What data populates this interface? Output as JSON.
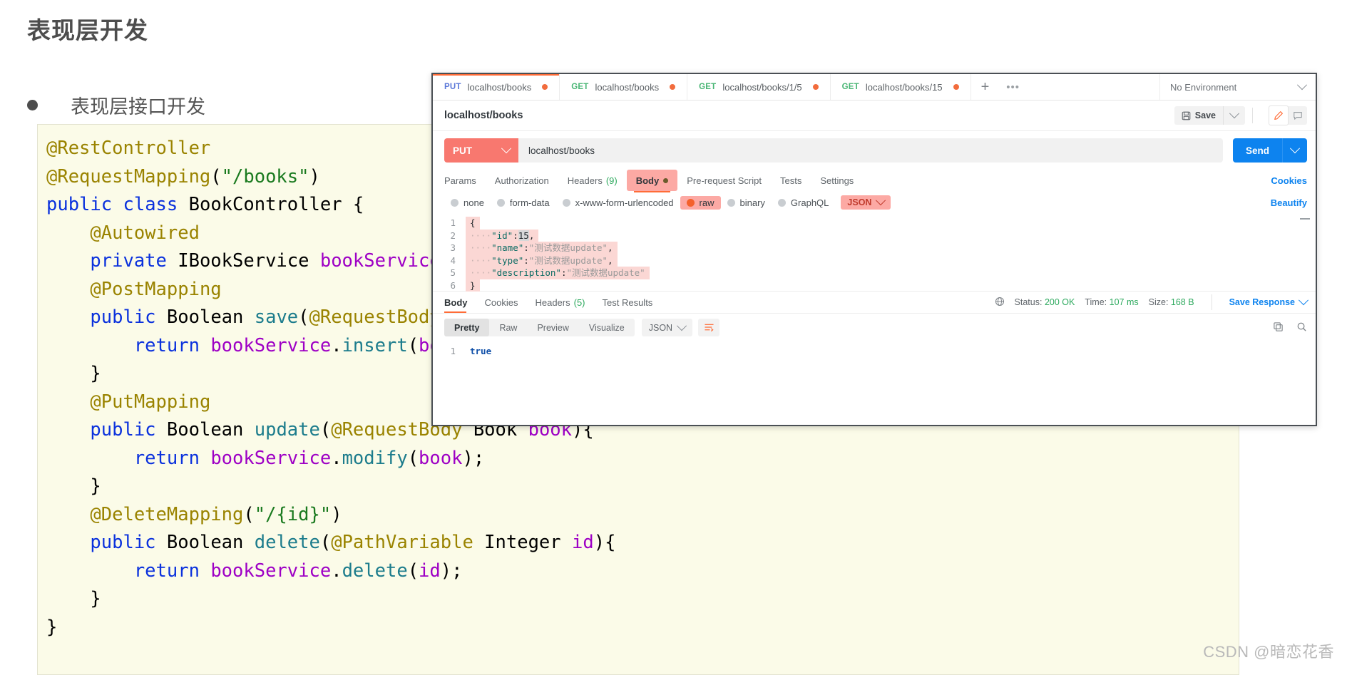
{
  "slide": {
    "title": "表现层开发",
    "bullet": "表现层接口开发",
    "watermark": "CSDN @暗恋花香"
  },
  "code": {
    "lines": [
      "@RestController",
      "@RequestMapping(\"/books\")",
      "public class BookController {",
      "    @Autowired",
      "    private IBookService bookService;",
      "    @PostMapping",
      "    public Boolean save(@RequestBody Book book){",
      "        return bookService.insert(book);",
      "    }",
      "    @PutMapping",
      "    public Boolean update(@RequestBody Book book){",
      "        return bookService.modify(book);",
      "    }",
      "    @DeleteMapping(\"/{id}\")",
      "    public Boolean delete(@PathVariable Integer id){",
      "        return bookService.delete(id);",
      "    }",
      "}"
    ]
  },
  "postman": {
    "tabs": [
      {
        "method": "PUT",
        "label": "localhost/books",
        "unsaved": true,
        "active": true
      },
      {
        "method": "GET",
        "label": "localhost/books",
        "unsaved": true,
        "active": false
      },
      {
        "method": "GET",
        "label": "localhost/books/1/5",
        "unsaved": true,
        "active": false
      },
      {
        "method": "GET",
        "label": "localhost/books/15",
        "unsaved": true,
        "active": false
      }
    ],
    "tab_add_label": "+",
    "tab_more_label": "•••",
    "environment": "No Environment",
    "request": {
      "name": "localhost/books",
      "save_label": "Save",
      "method": "PUT",
      "url": "localhost/books",
      "send_label": "Send",
      "tabs": [
        {
          "label": "Params",
          "selected": false
        },
        {
          "label": "Authorization",
          "selected": false
        },
        {
          "label": "Headers",
          "count": "(9)",
          "selected": false
        },
        {
          "label": "Body",
          "selected": true
        },
        {
          "label": "Pre-request Script",
          "selected": false
        },
        {
          "label": "Tests",
          "selected": false
        },
        {
          "label": "Settings",
          "selected": false
        }
      ],
      "cookies_link": "Cookies",
      "body_types": [
        {
          "label": "none",
          "selected": false
        },
        {
          "label": "form-data",
          "selected": false
        },
        {
          "label": "x-www-form-urlencoded",
          "selected": false
        },
        {
          "label": "raw",
          "selected": true
        },
        {
          "label": "binary",
          "selected": false
        },
        {
          "label": "GraphQL",
          "selected": false
        }
      ],
      "raw_format": "JSON",
      "beautify_link": "Beautify",
      "body_lines": [
        {
          "no": "1",
          "text": "{"
        },
        {
          "no": "2",
          "text": "····\"id\":15,"
        },
        {
          "no": "3",
          "text": "····\"name\":\"测试数据update\","
        },
        {
          "no": "4",
          "text": "····\"type\":\"测试数据update\","
        },
        {
          "no": "5",
          "text": "····\"description\":\"测试数据update\""
        },
        {
          "no": "6",
          "text": "}"
        }
      ]
    },
    "response": {
      "tabs": [
        {
          "label": "Body",
          "selected": true
        },
        {
          "label": "Cookies",
          "selected": false
        },
        {
          "label": "Headers",
          "count": "(5)",
          "selected": false
        },
        {
          "label": "Test Results",
          "selected": false
        }
      ],
      "status_label": "Status:",
      "status_value": "200 OK",
      "time_label": "Time:",
      "time_value": "107 ms",
      "size_label": "Size:",
      "size_value": "168 B",
      "save_response": "Save Response",
      "view_modes": [
        {
          "label": "Pretty",
          "selected": true
        },
        {
          "label": "Raw",
          "selected": false
        },
        {
          "label": "Preview",
          "selected": false
        },
        {
          "label": "Visualize",
          "selected": false
        }
      ],
      "format": "JSON",
      "body_lines": [
        {
          "no": "1",
          "text": "true"
        }
      ]
    }
  },
  "colors": {
    "accent_orange": "#ff6c37",
    "send_blue": "#0d83ef",
    "method_put": "#f8786f",
    "success_green": "#2faa5f"
  }
}
